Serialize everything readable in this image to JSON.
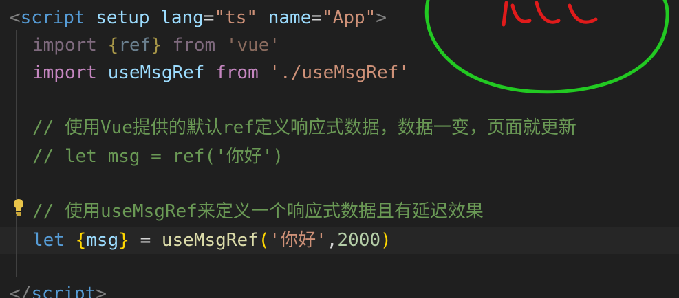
{
  "code": {
    "line1": {
      "open": "<",
      "tag": "script",
      "attr1": "setup",
      "attr2": "lang",
      "eq": "=",
      "val2": "\"ts\"",
      "attr3": "name",
      "val3": "\"App\"",
      "close": ">"
    },
    "line2": {
      "kw": "import",
      "brace_open": "{",
      "name": "ref",
      "brace_close": "}",
      "from": "from",
      "src": "'vue'"
    },
    "line3": {
      "kw": "import",
      "name": "useMsgRef",
      "from": "from",
      "src": "'./useMsgRef'"
    },
    "line5": {
      "comment": "// 使用Vue提供的默认ref定义响应式数据，数据一变，页面就更新"
    },
    "line6": {
      "comment": "// let msg = ref('你好')"
    },
    "line8": {
      "comment": "// 使用useMsgRef来定义一个响应式数据且有延迟效果"
    },
    "line9": {
      "kw": "let",
      "brace_open": "{",
      "name": "msg",
      "brace_close": "}",
      "eq": "=",
      "fn": "useMsgRef",
      "paren_open": "(",
      "str": "'你好'",
      "comma": ",",
      "num": "2000",
      "paren_close": ")"
    },
    "line11": {
      "open": "</",
      "tag": "script",
      "close": ">"
    }
  },
  "colors": {
    "background": "#1f1f1f",
    "comment": "#6a9955",
    "keyword": "#c586c0",
    "variable": "#9cdcfe",
    "string": "#ce9178",
    "function": "#dcdcaa",
    "number": "#b5cea8",
    "brace": "#ffd700",
    "annotation": "#22c922"
  },
  "icons": [
    "lightbulb-icon"
  ]
}
